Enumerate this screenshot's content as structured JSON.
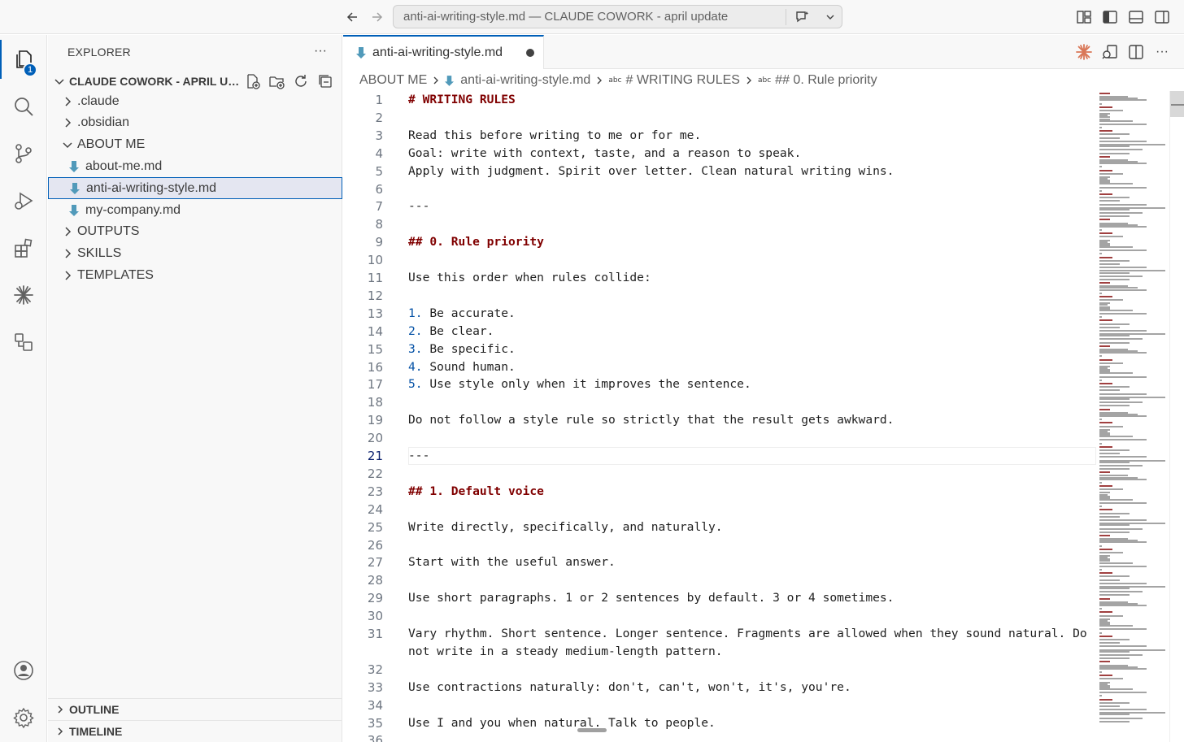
{
  "titlebar": {
    "command_center": "anti-ai-writing-style.md — CLAUDE COWORK - april update",
    "back_icon": "arrow-left-icon",
    "forward_icon": "arrow-right-icon",
    "chat_icon": "chat-sparkle-icon",
    "layout_icons": [
      "customize-layout-icon",
      "toggle-primary-sidebar-icon",
      "toggle-panel-icon",
      "toggle-secondary-sidebar-icon"
    ]
  },
  "activity_bar": {
    "items": [
      {
        "name": "explorer-icon",
        "active": true,
        "badge": "1"
      },
      {
        "name": "search-icon"
      },
      {
        "name": "source-control-icon"
      },
      {
        "name": "run-debug-icon"
      },
      {
        "name": "extensions-icon"
      },
      {
        "name": "claude-icon"
      },
      {
        "name": "remote-explorer-icon"
      }
    ],
    "bottom": [
      {
        "name": "account-icon"
      },
      {
        "name": "settings-gear-icon"
      }
    ]
  },
  "sidebar": {
    "title": "EXPLORER",
    "more": "···",
    "workspace": "CLAUDE COWORK - APRIL UPDATE",
    "tree": [
      {
        "label": ".claude",
        "type": "folder",
        "expanded": false,
        "depth": 0
      },
      {
        "label": ".obsidian",
        "type": "folder",
        "expanded": false,
        "depth": 0
      },
      {
        "label": "ABOUT ME",
        "type": "folder",
        "expanded": true,
        "depth": 0
      },
      {
        "label": "about-me.md",
        "type": "file",
        "depth": 1
      },
      {
        "label": "anti-ai-writing-style.md",
        "type": "file",
        "depth": 1,
        "selected": true
      },
      {
        "label": "my-company.md",
        "type": "file",
        "depth": 1
      },
      {
        "label": "OUTPUTS",
        "type": "folder",
        "expanded": false,
        "depth": 0
      },
      {
        "label": "SKILLS",
        "type": "folder",
        "expanded": false,
        "depth": 0
      },
      {
        "label": "TEMPLATES",
        "type": "folder",
        "expanded": false,
        "depth": 0
      }
    ],
    "outline": "OUTLINE",
    "timeline": "TIMELINE"
  },
  "tab": {
    "label": "anti-ai-writing-style.md",
    "dirty": true
  },
  "breadcrumb": {
    "folder": "ABOUT ME",
    "file": "anti-ai-writing-style.md",
    "symbol_tag": "abc",
    "section1": "# WRITING RULES",
    "section2": "## 0. Rule priority"
  },
  "editor": {
    "current_line": 21,
    "lines": [
      {
        "n": "1",
        "text": "# WRITING RULES",
        "kind": "heading"
      },
      {
        "n": "2",
        "text": ""
      },
      {
        "n": "3",
        "text": "Read this before writing to me or for me."
      },
      {
        "n": "4",
        "text": "Goal: write with context, taste, and a reason to speak."
      },
      {
        "n": "5",
        "text": "Apply with judgment. Spirit over letter. Clean natural writing wins."
      },
      {
        "n": "6",
        "text": ""
      },
      {
        "n": "7",
        "text": "---"
      },
      {
        "n": "8",
        "text": ""
      },
      {
        "n": "9",
        "text": "## 0. Rule priority",
        "kind": "heading"
      },
      {
        "n": "10",
        "text": ""
      },
      {
        "n": "11",
        "text": "Use this order when rules collide:"
      },
      {
        "n": "12",
        "text": ""
      },
      {
        "n": "13",
        "text": "Be accurate.",
        "num": "1."
      },
      {
        "n": "14",
        "text": "Be clear.",
        "num": "2."
      },
      {
        "n": "15",
        "text": "Be specific.",
        "num": "3."
      },
      {
        "n": "16",
        "text": "Sound human.",
        "num": "4."
      },
      {
        "n": "17",
        "text": "Use style only when it improves the sentence.",
        "num": "5."
      },
      {
        "n": "18",
        "text": ""
      },
      {
        "n": "19",
        "text": "Do not follow a style rule so strictly that the result gets awkward."
      },
      {
        "n": "20",
        "text": ""
      },
      {
        "n": "21",
        "text": "---"
      },
      {
        "n": "22",
        "text": ""
      },
      {
        "n": "23",
        "text": "## 1. Default voice",
        "kind": "heading"
      },
      {
        "n": "24",
        "text": ""
      },
      {
        "n": "25",
        "text": "Write directly, specifically, and naturally."
      },
      {
        "n": "26",
        "text": ""
      },
      {
        "n": "27",
        "text": "Start with the useful answer."
      },
      {
        "n": "28",
        "text": ""
      },
      {
        "n": "29",
        "text": "Use short paragraphs. 1 or 2 sentences by default. 3 or 4 sometimes."
      },
      {
        "n": "30",
        "text": ""
      },
      {
        "n": "31",
        "text": "Vary rhythm. Short sentence. Longer sentence. Fragments are allowed when they sound natural. Do"
      },
      {
        "n": "",
        "text": "not write in a steady medium-length pattern."
      },
      {
        "n": "32",
        "text": ""
      },
      {
        "n": "33",
        "text": "Use contractions naturally: don't, can't, won't, it's, you're."
      },
      {
        "n": "34",
        "text": ""
      },
      {
        "n": "35",
        "text": "Use I and you when natural. Talk to people."
      },
      {
        "n": "36",
        "text": ""
      }
    ]
  },
  "top_right_icons": [
    "claude-spark-icon",
    "open-preview-icon",
    "split-editor-icon",
    "more-actions-icon"
  ],
  "colors": {
    "accent": "#005fb8",
    "heading": "#800000",
    "list_number": "#0451a5",
    "claude_orange": "#d97757",
    "markdown_icon": "#519aba"
  }
}
